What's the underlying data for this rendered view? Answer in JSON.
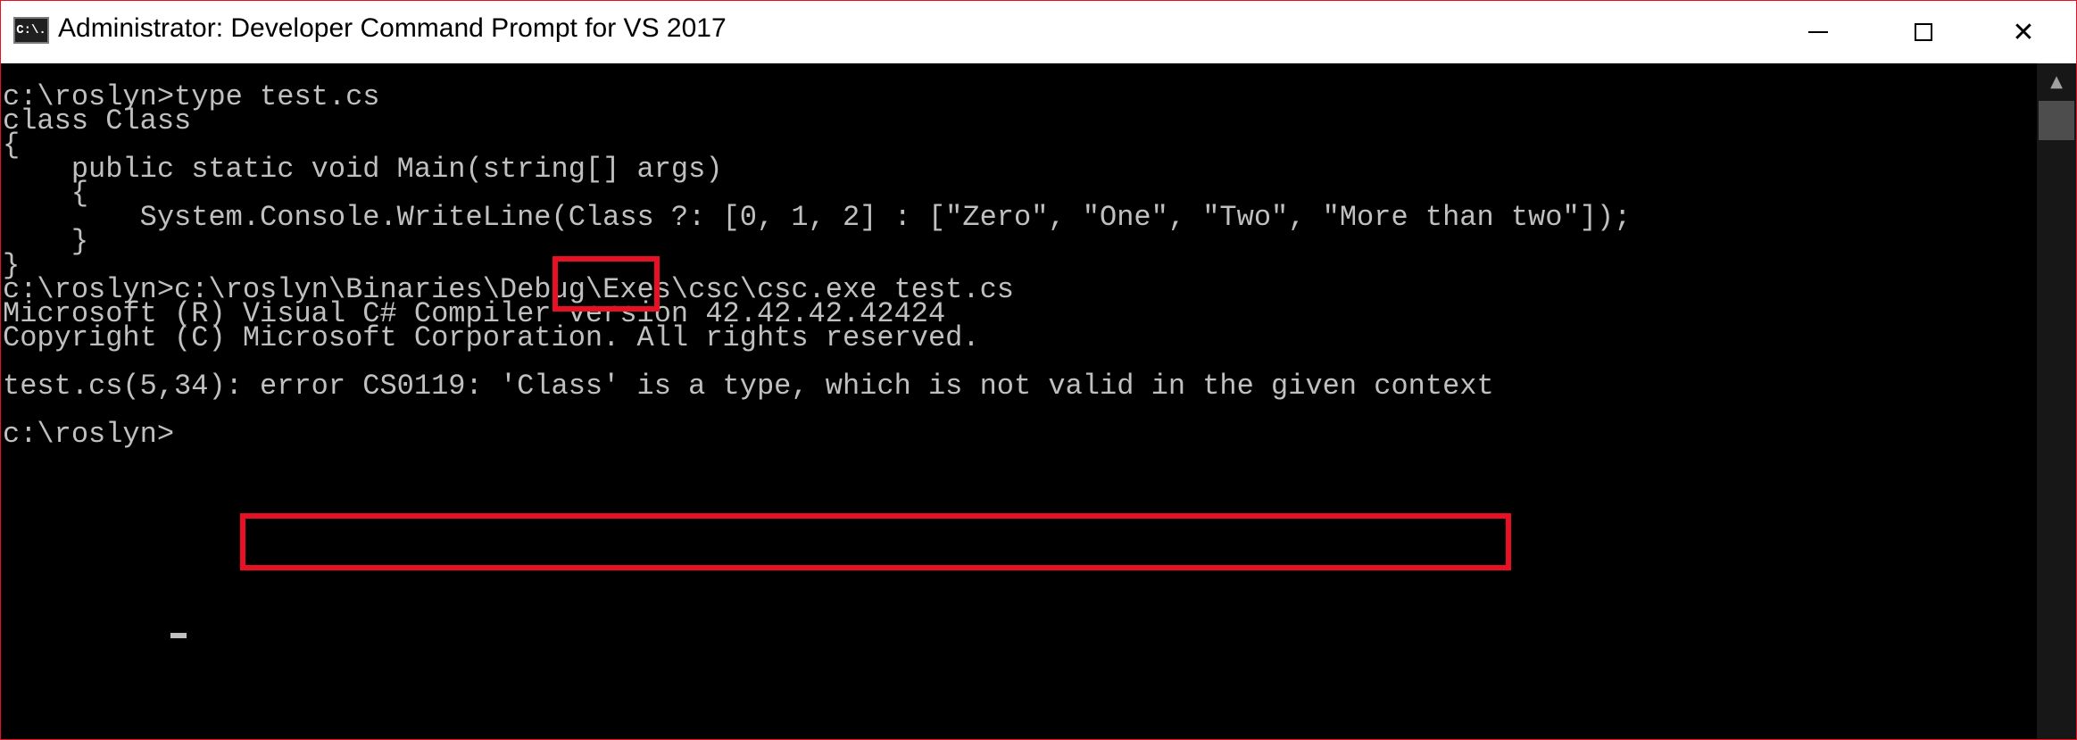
{
  "window": {
    "title": "Administrator: Developer Command Prompt for VS 2017",
    "icon_label": "C:\\.",
    "icons": {
      "minimize": "minimize-icon",
      "maximize": "maximize-icon",
      "close": "close-icon"
    },
    "close_glyph": "✕"
  },
  "console": {
    "lines": [
      "c:\\roslyn>type test.cs",
      "class Class",
      "{",
      "    public static void Main(string[] args)",
      "    {",
      "        System.Console.WriteLine(Class ?: [0, 1, 2] : [\"Zero\", \"One\", \"Two\", \"More than two\"]);",
      "    }",
      "}",
      "c:\\roslyn>c:\\roslyn\\Binaries\\Debug\\Exes\\csc\\csc.exe test.cs",
      "Microsoft (R) Visual C# Compiler version 42.42.42.42424",
      "Copyright (C) Microsoft Corporation. All rights reserved.",
      "",
      "test.cs(5,34): error CS0119: 'Class' is a type, which is not valid in the given context",
      "",
      "c:\\roslyn>"
    ]
  },
  "colors": {
    "highlight": "#e81123",
    "console_text": "#c0c0c0",
    "console_bg": "#000000"
  },
  "scrollbar": {
    "up_arrow_glyph": "▲"
  }
}
